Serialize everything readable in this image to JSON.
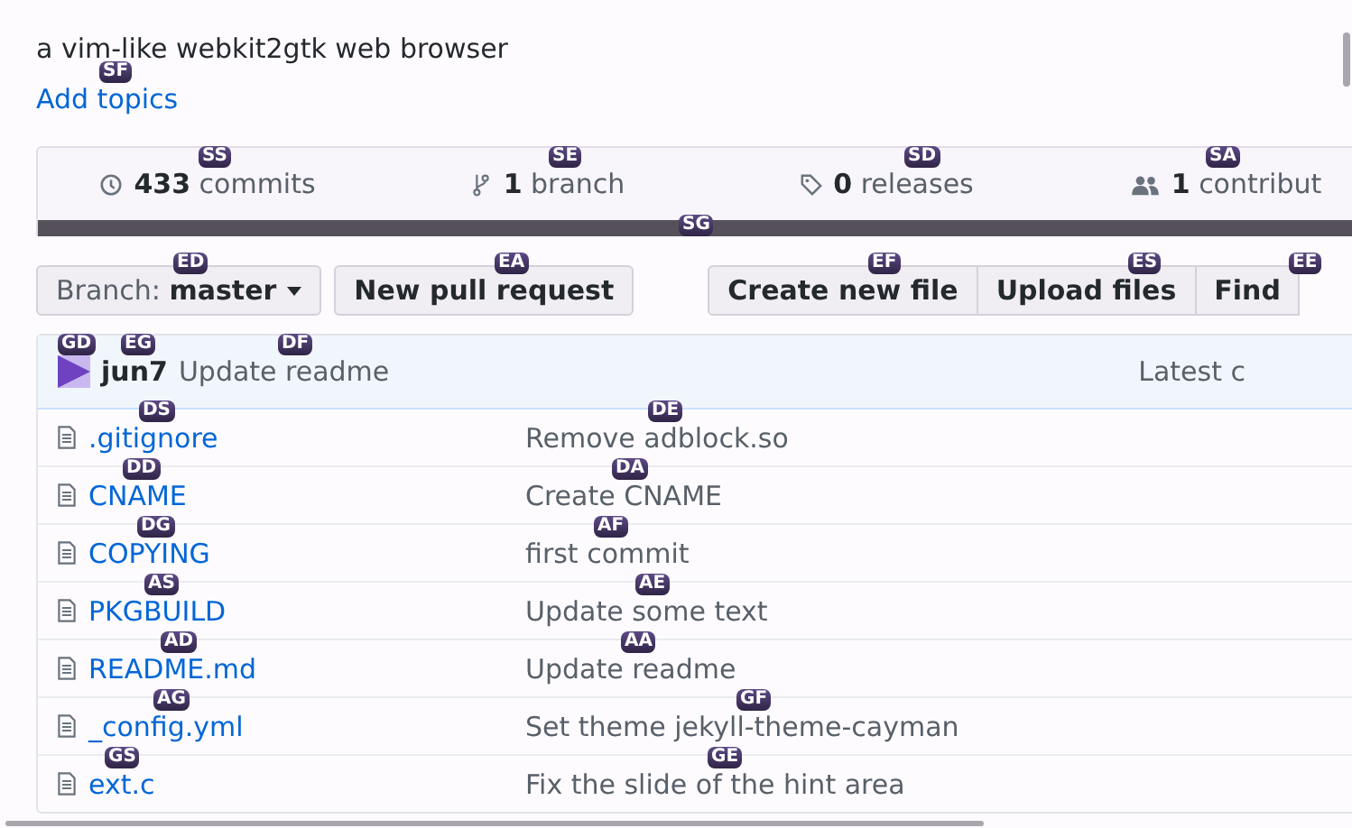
{
  "description": "a vim-like webkit2gtk web browser",
  "add_topics": "Add topics",
  "stats": [
    {
      "kind": "commits",
      "count": "433",
      "label": "commits"
    },
    {
      "kind": "branch",
      "count": "1",
      "label": "branch"
    },
    {
      "kind": "releases",
      "count": "0",
      "label": "releases"
    },
    {
      "kind": "contributors",
      "count": "1",
      "label": "contribut"
    }
  ],
  "branch_select": {
    "label": "Branch:",
    "value": "master"
  },
  "buttons_left": [
    "New pull request"
  ],
  "buttons_right": [
    "Create new file",
    "Upload files",
    "Find"
  ],
  "latest_commit": {
    "author": "jun7",
    "message": "Update readme",
    "meta": "Latest c"
  },
  "files": [
    {
      "name": ".gitignore",
      "message": "Remove adblock.so"
    },
    {
      "name": "CNAME",
      "message": "Create CNAME"
    },
    {
      "name": "COPYING",
      "message": "first commit"
    },
    {
      "name": "PKGBUILD",
      "message": "Update some text"
    },
    {
      "name": "README.md",
      "message": "Update readme"
    },
    {
      "name": "_config.yml",
      "message": "Set theme jekyll-theme-cayman"
    },
    {
      "name": "ext.c",
      "message": "Fix the slide of the hint area"
    }
  ],
  "hints": [
    {
      "label": "SF"
    },
    {
      "label": "SS"
    },
    {
      "label": "SE"
    },
    {
      "label": "SD"
    },
    {
      "label": "SA"
    },
    {
      "label": "SG"
    },
    {
      "label": "ED"
    },
    {
      "label": "EA"
    },
    {
      "label": "EF"
    },
    {
      "label": "ES"
    },
    {
      "label": "EE"
    },
    {
      "label": "GD"
    },
    {
      "label": "EG"
    },
    {
      "label": "DF"
    },
    {
      "label": "DS"
    },
    {
      "label": "DE"
    },
    {
      "label": "DD"
    },
    {
      "label": "DA"
    },
    {
      "label": "DG"
    },
    {
      "label": "AF"
    },
    {
      "label": "AS"
    },
    {
      "label": "AE"
    },
    {
      "label": "AD"
    },
    {
      "label": "AA"
    },
    {
      "label": "AG"
    },
    {
      "label": "GF"
    },
    {
      "label": "GS"
    },
    {
      "label": "GE"
    }
  ]
}
